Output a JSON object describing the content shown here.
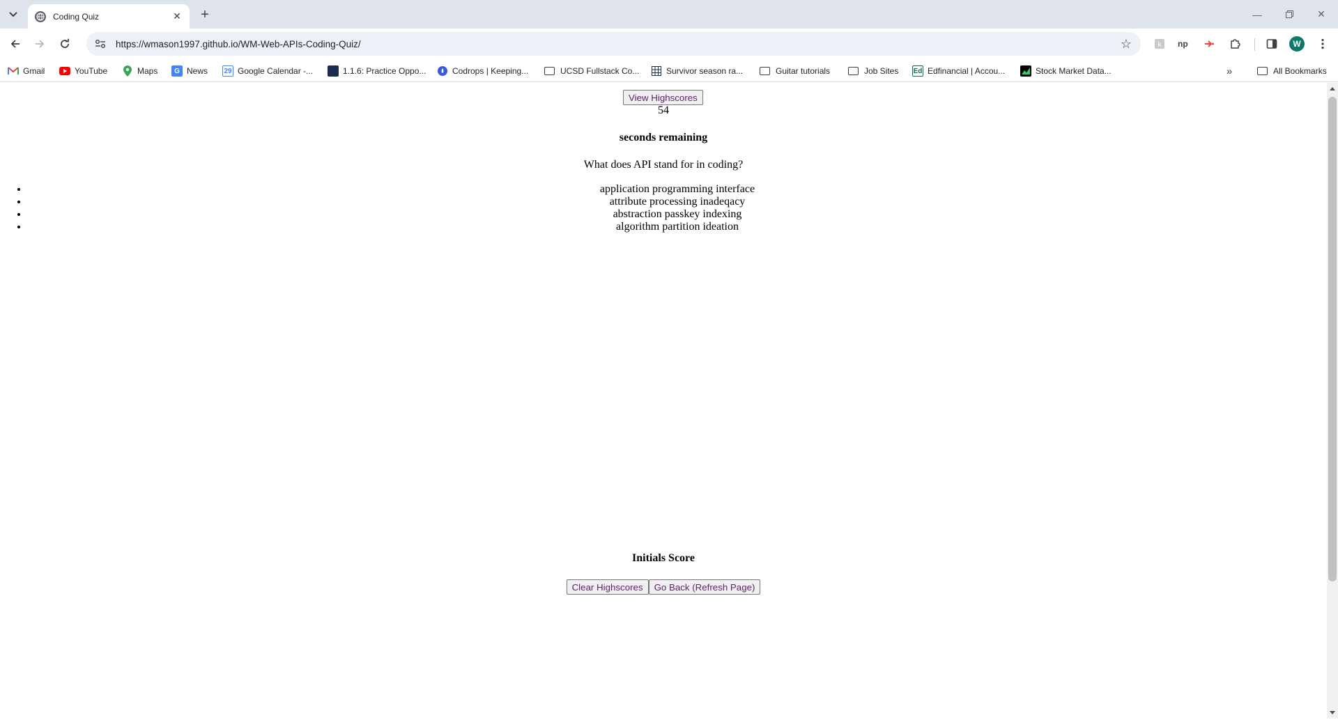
{
  "browser": {
    "tab_title": "Coding Quiz",
    "url": "https://wmason1997.github.io/WM-Web-APIs-Coding-Quiz/",
    "avatar_letter": "W",
    "bookmarks": [
      {
        "label": "Gmail",
        "icon": "gmail-icon",
        "color": "#ea4335"
      },
      {
        "label": "YouTube",
        "icon": "youtube-icon",
        "color": "#ff0000"
      },
      {
        "label": "Maps",
        "icon": "maps-icon",
        "color": "#34a853"
      },
      {
        "label": "News",
        "icon": "news-icon",
        "color": "#4285f4"
      },
      {
        "label": "Google Calendar -...",
        "icon": "calendar-icon",
        "color": "#4285f4"
      },
      {
        "label": "1.1.6: Practice Oppo...",
        "icon": "course-icon",
        "color": "#1a2b4c"
      },
      {
        "label": "Codrops | Keeping...",
        "icon": "codrops-icon",
        "color": "#3a5bd9"
      },
      {
        "label": "UCSD Fullstack Co...",
        "icon": "folder-icon"
      },
      {
        "label": "Survivor season ra...",
        "icon": "grid-icon",
        "color": "#1a2b4c"
      },
      {
        "label": "Guitar tutorials",
        "icon": "folder-icon"
      },
      {
        "label": "Job Sites",
        "icon": "folder-icon"
      },
      {
        "label": "Edfinancial | Accou...",
        "icon": "edfinancial-icon",
        "color": "#0a6e4f"
      },
      {
        "label": "Stock Market Data...",
        "icon": "chart-icon",
        "color": "#000000"
      }
    ],
    "all_bookmarks_label": "All Bookmarks"
  },
  "quiz": {
    "view_highscores_label": "View Highscores",
    "timer_value": "54",
    "timer_label": "seconds remaining",
    "question": "What does API stand for in coding?",
    "answers": [
      "application programming interface",
      "attribute processing inadeqacy",
      "abstraction passkey indexing",
      "algorithm partition ideation"
    ]
  },
  "highscores": {
    "title": "Initials Score",
    "clear_label": "Clear Highscores",
    "back_label": "Go Back (Refresh Page)"
  }
}
